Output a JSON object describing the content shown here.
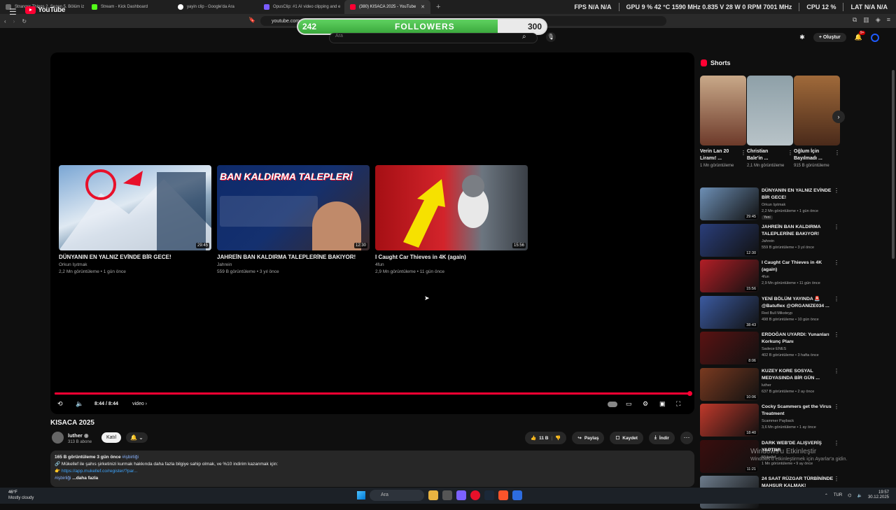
{
  "browser": {
    "tabs": [
      {
        "label": "Stranger Things 2. Sezon 5. Bölüm iz",
        "color": "#6b6b6b"
      },
      {
        "label": "Stream - Kick Dashboard",
        "color": "#53fc18"
      },
      {
        "label": "yayin clip - Google'da Ara",
        "color": "#ffffff"
      },
      {
        "label": "OpusClip: #1 AI video clipping and e",
        "color": "#7a5cff"
      },
      {
        "label": "(380) KISACA 2025 - YouTube",
        "color": "#ff0033"
      }
    ],
    "new_tab": "+",
    "url": "youtube.com"
  },
  "hud": {
    "fps_label": "FPS",
    "fps_val": "N/A",
    "fps_val2": "N/A",
    "gpu_label": "GPU",
    "gpu_pct": "9 %",
    "gpu_temp": "42 °C",
    "gpu_clock": "1590 MHz",
    "gpu_volt": "0.835 V",
    "gpu_power": "28 W",
    "gpu_fan": "0 RPM",
    "gpu_mem": "7001 MHz",
    "cpu_label": "CPU",
    "cpu_pct": "12 %",
    "lat_label": "LAT",
    "lat_val": "N/A",
    "lat_val2": "N/A"
  },
  "followers_widget": {
    "current": "242",
    "label": "FOLLOWERS",
    "target": "300",
    "progress": 0.806
  },
  "youtube": {
    "logo": "YouTube",
    "search_placeholder": "Ara",
    "create_label": "Oluştur",
    "notif_badge": "9+"
  },
  "player": {
    "timecode": "8:44 / 8:44",
    "chapter": "video ›",
    "progress": 1.0,
    "endcards": [
      {
        "title": "DÜNYANIN EN YALNIZ EVİNDE BİR GECE!",
        "channel": "Orkun Işıtmak",
        "meta": "2,2 Mn görüntüleme • 1 gün önce",
        "duration": "29:45",
        "thumb_text": ""
      },
      {
        "title": "JAHREİN BAN KALDIRMA TALEPLERİNE BAKIYOR!",
        "channel": "Jahrein",
        "meta": "559 B görüntüleme • 3 yıl önce",
        "duration": "12:30",
        "thumb_text": "BAN KALDIRMA TALEPLERİ"
      },
      {
        "title": "I Caught Car Thieves in 4K (again)",
        "channel": "4fun",
        "meta": "2,9 Mn görüntüleme • 11 gün önce",
        "duration": "15:56",
        "thumb_text": ""
      }
    ]
  },
  "video": {
    "title": "KISACA 2025",
    "channel": "luther",
    "subs": "313 B abone",
    "join": "Katıl",
    "likes": "11 B",
    "share": "Paylaş",
    "save": "Kaydet",
    "download": "İndir",
    "desc_stats": "165 B görüntüleme  3 gün önce",
    "desc_tag": "#işbirliği",
    "desc_line": "🔗 Mükellef ile şahıs şirketinizi kurmak hakkında daha fazla bilgiye sahip olmak, ve %10 indirim kazanmak için:",
    "desc_link": "👉 https://app.mukellef.co/register/?par...",
    "desc_more_tag": "#işbirliği",
    "desc_more": "...daha fazla"
  },
  "shorts": {
    "heading": "Shorts",
    "items": [
      {
        "title": "Verin Lan 20 Liramı! ...",
        "views": "1 Mn görüntüleme"
      },
      {
        "title": "Christian Bale'in ...",
        "views": "2,1 Mn görüntüleme"
      },
      {
        "title": "Oğlum İçin Bayılmadı ...",
        "views": "915 B görüntüleme"
      }
    ]
  },
  "recommendations": [
    {
      "title": "DÜNYANIN EN YALNIZ EVİNDE BİR GECE!",
      "channel": "Orkun Işıtmak",
      "meta": "2,2 Mn görüntüleme • 1 gün önce",
      "duration": "29:45",
      "badge": "Yeni",
      "color": "#6d8fb5"
    },
    {
      "title": "JAHREİN BAN KALDIRMA TALEPLERİNE BAKIYOR!",
      "channel": "Jahrein",
      "meta": "559 B görüntüleme • 3 yıl önce",
      "duration": "12:30",
      "badge": "",
      "color": "#2a3e7a"
    },
    {
      "title": "I Caught Car Thieves in 4K (again)",
      "channel": "4fun",
      "meta": "2,9 Mn görüntüleme • 11 gün önce",
      "duration": "15:56",
      "badge": "",
      "color": "#b21e26"
    },
    {
      "title": "YENİ BÖLÜM YAYINDA 🚨 @Batuflex @ORGANIZE034 ...",
      "channel": "Red Bull Mikstеyp",
      "meta": "498 B görüntüleme • 10 gün önce",
      "duration": "38:43",
      "badge": "",
      "color": "#3b5aa0"
    },
    {
      "title": "ERDOĞAN UYARDI: Yunanları Korkunç Planı",
      "channel": "Sadece ENES",
      "meta": "402 B görüntüleme • 3 hafta önce",
      "duration": "8:06",
      "badge": "",
      "color": "#5a1212"
    },
    {
      "title": "KUZEY KORE SOSYAL MEDYASINDA BİR GÜN ...",
      "channel": "luther",
      "meta": "637 B görüntüleme • 2 ay önce",
      "duration": "10:06",
      "badge": "",
      "color": "#7a3a20"
    },
    {
      "title": "Cocky Scammers get the Virus Treatment",
      "channel": "Scammer Payback",
      "meta": "3,6 Mn görüntüleme • 1 ay önce",
      "duration": "18:40",
      "badge": "",
      "color": "#c0392b"
    },
    {
      "title": "DARK WEB'DE ALIŞVERİŞ YAPTIM!",
      "channel": "Mükellef",
      "meta": "1 Mn görüntüleme • 9 ay önce",
      "duration": "11:21",
      "badge": "",
      "color": "#3a0d0d"
    },
    {
      "title": "24 SAAT RÜZGAR TÜRBİNİNDE MAHSUR KALMAK!",
      "channel": "",
      "meta": "",
      "duration": "",
      "badge": "",
      "color": "#6d7c8c"
    }
  ],
  "overlay": {
    "activate": "Windows'u Etkinleştir",
    "activate_sub": "Windows'u etkinleştirmek için Ayarlar'a gidin."
  },
  "taskbar": {
    "temp": "46°F",
    "weather": "Mostly cloudy",
    "search": "Ara",
    "lang": "TUR",
    "time": "19:57",
    "date": "30.12.2025"
  }
}
